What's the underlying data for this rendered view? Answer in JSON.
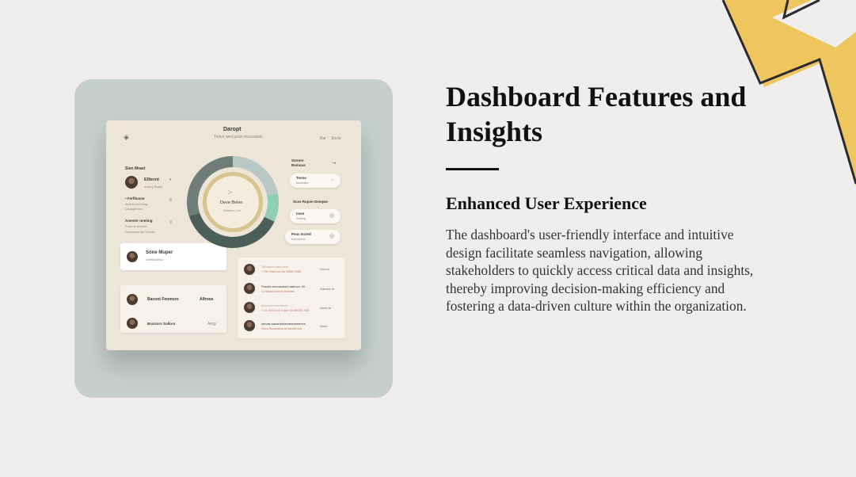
{
  "slide": {
    "title": "Dashboard Features and Insights",
    "subtitle": "Enhanced User Experience",
    "body": "The dashboard's user-friendly interface and intuitive design facilitate seamless navigation, allowing stakeholders to quickly access critical data and insights, thereby improving decision-making efficiency and fostering a data-driven culture within the organization."
  },
  "mock_dashboard": {
    "header_title": "Daropt",
    "header_sub": "Tietvo wesl poot rteosvanuk",
    "header_links": [
      "Bar",
      "Socie"
    ],
    "left_heading": "Sien Mraet",
    "profile_name": "Ellternt",
    "profile_sub": "Antoty Rarke",
    "stat1_title": "• Ferfliusne",
    "stat1_lines": [
      "Alnd to tornetng",
      "Lavagetrnes"
    ],
    "stat1_value": "8",
    "stat2_title": "Anenter oneting",
    "stat2_lines": [
      "Ford no etnaire",
      "Surnepdonde Shosle"
    ],
    "stat2_value": "9",
    "card_name": "Sone Muper",
    "card_sub": "Antesnaetoo",
    "contacts": [
      {
        "name": "Bacont  Fenmoro",
        "tag": "Alfrooe"
      },
      {
        "name": "Brarsors  Sollors",
        "tag": "Aegy"
      }
    ],
    "donut_name": "Deve Belen",
    "donut_sub": "Suleneo, Ce",
    "donut_segments": [
      {
        "value": 22,
        "color": "#b9c8c4"
      },
      {
        "value": 10,
        "color": "#8fd0b5"
      },
      {
        "value": 38,
        "color": "#4c5e58"
      },
      {
        "value": 30,
        "color": "#6e7d78"
      }
    ],
    "right_top_label": "Sonner\nRemoue",
    "right_section": "Sces Ropen Deeqwe",
    "pills": [
      {
        "title": "Tenne",
        "sub": "Aunliopee"
      },
      {
        "title": "Iseet",
        "sub": "Seiteng"
      },
      {
        "title": "Peac Iscted",
        "sub": "Aoleoteene"
      }
    ],
    "list_rows": [
      {
        "title": "Talvotien stannosts",
        "sub": "+ Oh Sarnom Ne 3008 2020",
        "tag": "Donne"
      },
      {
        "title": "Feseet aerrossteed aaecsm 39",
        "sub": "Ci mand Dondt Innenes",
        "tag": "Daevee  Ie"
      },
      {
        "title": "Aeucsreerseneene",
        "sub": "+ eI: 3000 nd 3 ase 40 30003 300",
        "tag": "Deee  Ie"
      },
      {
        "title": "Isevas saeaniesienaaeseeeeen",
        "sub": "Ooro Bocenicra ht stenerrrns",
        "tag": "Deee"
      }
    ]
  }
}
